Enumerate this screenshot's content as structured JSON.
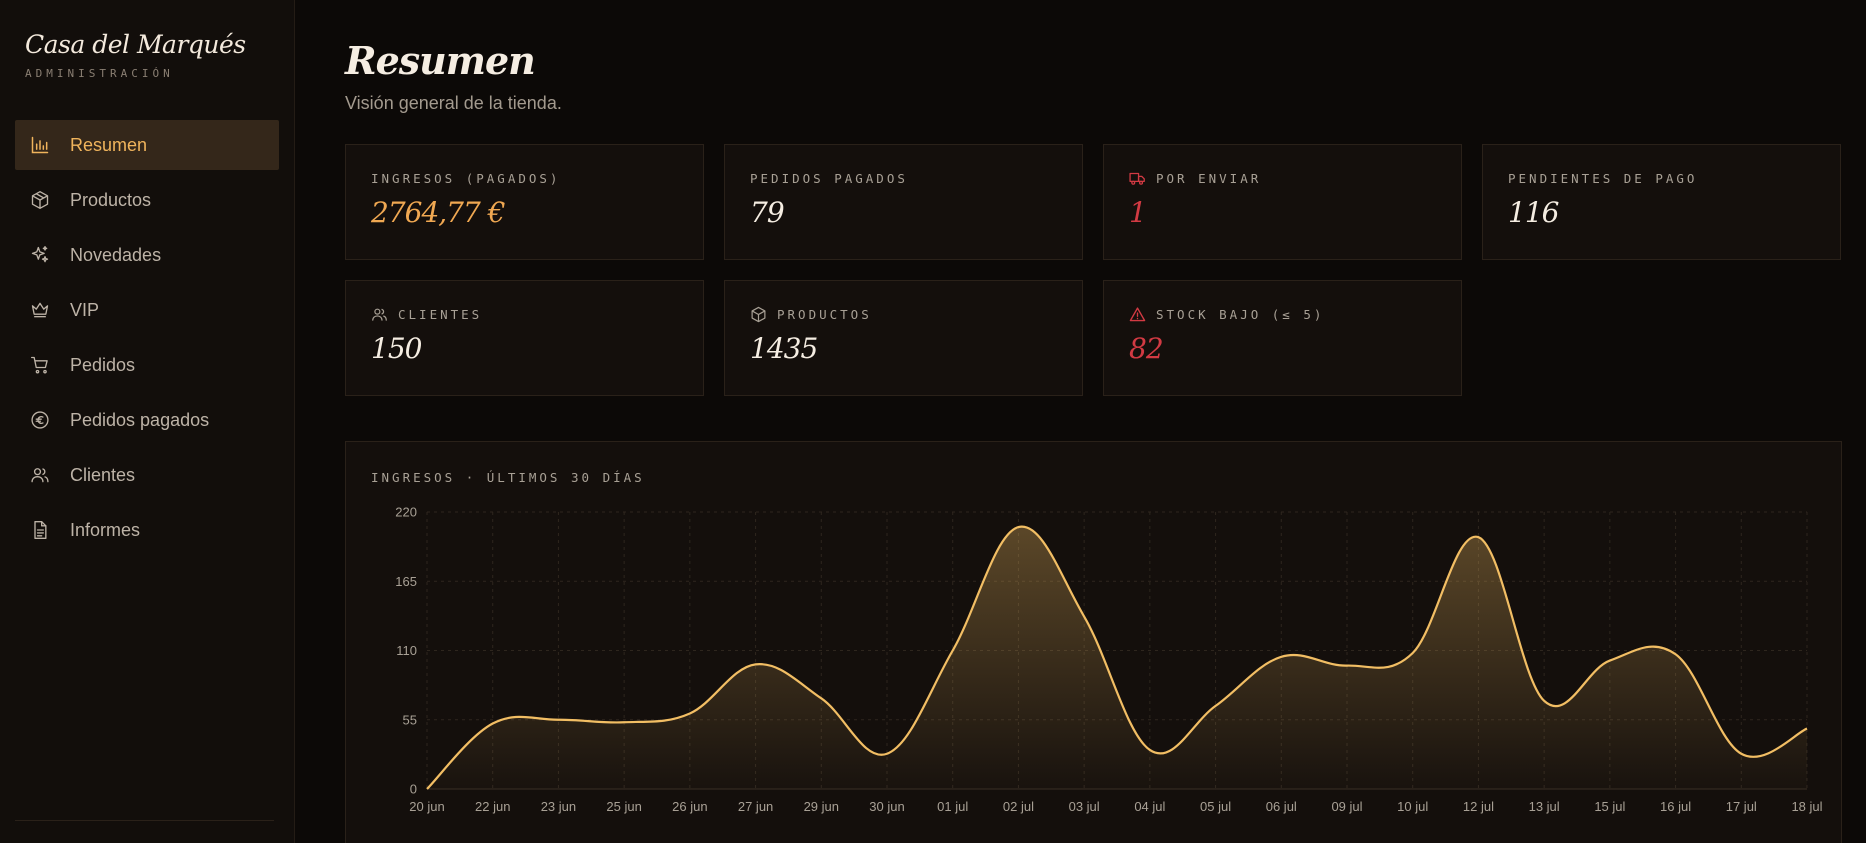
{
  "sidebar": {
    "brand_title": "Casa del Marqués",
    "brand_subtitle": "ADMINISTRACIÓN",
    "items": [
      {
        "label": "Resumen",
        "icon": "bar-chart-icon",
        "active": true
      },
      {
        "label": "Productos",
        "icon": "box-icon"
      },
      {
        "label": "Novedades",
        "icon": "sparkles-icon"
      },
      {
        "label": "VIP",
        "icon": "crown-icon"
      },
      {
        "label": "Pedidos",
        "icon": "cart-icon"
      },
      {
        "label": "Pedidos pagados",
        "icon": "euro-circle-icon"
      },
      {
        "label": "Clientes",
        "icon": "users-icon"
      },
      {
        "label": "Informes",
        "icon": "document-icon"
      }
    ]
  },
  "header": {
    "title": "Resumen",
    "subtitle": "Visión general de la tienda."
  },
  "cards": [
    {
      "label": "INGRESOS (PAGADOS)",
      "value": "2764,77 €",
      "tone": "gold"
    },
    {
      "label": "PEDIDOS PAGADOS",
      "value": "79"
    },
    {
      "label": "POR ENVIAR",
      "value": "1",
      "tone": "red",
      "icon": "truck-icon"
    },
    {
      "label": "PENDIENTES DE PAGO",
      "value": "116"
    },
    {
      "label": "CLIENTES",
      "value": "150",
      "icon": "users-icon"
    },
    {
      "label": "PRODUCTOS",
      "value": "1435",
      "icon": "box-icon"
    },
    {
      "label": "STOCK BAJO (≤ 5)",
      "value": "82",
      "tone": "red",
      "icon": "alert-triangle-icon"
    }
  ],
  "colors": {
    "accent": "#f0b45c",
    "alert": "#d23a43",
    "line": "#f2be64"
  },
  "chart_data": {
    "type": "area",
    "title": "INGRESOS · ÚLTIMOS 30 DÍAS",
    "categories": [
      "20 jun",
      "22 jun",
      "23 jun",
      "25 jun",
      "26 jun",
      "27 jun",
      "29 jun",
      "30 jun",
      "01 jul",
      "02 jul",
      "03 jul",
      "04 jul",
      "05 jul",
      "06 jul",
      "09 jul",
      "10 jul",
      "12 jul",
      "13 jul",
      "15 jul",
      "16 jul",
      "17 jul",
      "18 jul"
    ],
    "values": [
      0,
      52,
      55,
      53,
      60,
      99,
      72,
      28,
      110,
      208,
      137,
      31,
      66,
      105,
      98,
      108,
      200,
      70,
      102,
      107,
      28,
      48
    ],
    "yticks": [
      "0",
      "55",
      "110",
      "165",
      "220"
    ],
    "ylim": [
      0,
      220
    ],
    "grid": true
  }
}
